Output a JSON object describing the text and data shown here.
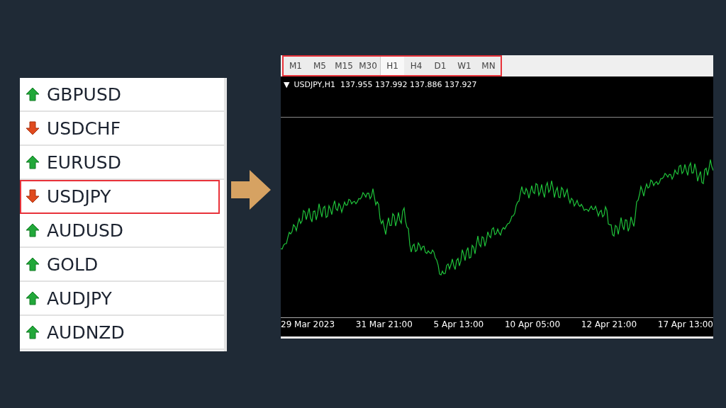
{
  "symbols": [
    {
      "name": "GBPUSD",
      "kind": "up",
      "selected": false
    },
    {
      "name": "USDCHF",
      "kind": "down",
      "selected": false
    },
    {
      "name": "EURUSD",
      "kind": "up",
      "selected": false
    },
    {
      "name": "USDJPY",
      "kind": "down",
      "selected": true
    },
    {
      "name": "AUDUSD",
      "kind": "up",
      "selected": false
    },
    {
      "name": "GOLD",
      "kind": "up",
      "selected": false
    },
    {
      "name": "AUDJPY",
      "kind": "up",
      "selected": false
    },
    {
      "name": "AUDNZD",
      "kind": "up",
      "selected": false
    }
  ],
  "timeframes": [
    {
      "label": "M1",
      "selected": false
    },
    {
      "label": "M5",
      "selected": false
    },
    {
      "label": "M15",
      "selected": false
    },
    {
      "label": "M30",
      "selected": false
    },
    {
      "label": "H1",
      "selected": true
    },
    {
      "label": "H4",
      "selected": false
    },
    {
      "label": "D1",
      "selected": false
    },
    {
      "label": "W1",
      "selected": false
    },
    {
      "label": "MN",
      "selected": false
    }
  ],
  "chart": {
    "marker": "▼",
    "header": "USDJPY,H1  137.955 137.992 137.886 137.927",
    "time_labels": [
      "29 Mar 2023",
      "31 Mar 21:00",
      "5 Apr 13:00",
      "10 Apr 05:00",
      "12 Apr 21:00",
      "17 Apr 13:00"
    ]
  }
}
